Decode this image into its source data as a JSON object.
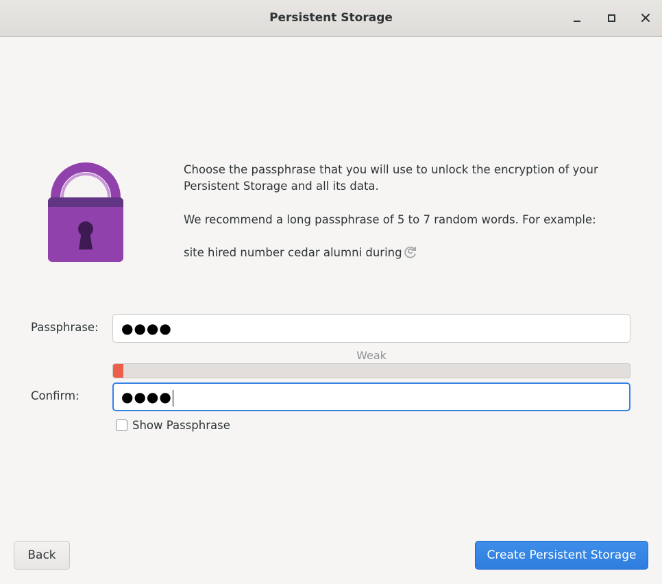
{
  "window": {
    "title": "Persistent Storage",
    "controls": {
      "minimize_icon": "minimize-icon",
      "maximize_icon": "maximize-icon",
      "close_icon": "close-icon"
    }
  },
  "illustration": {
    "icon": "padlock-icon",
    "color": "#9141ac"
  },
  "intro": {
    "line1": "Choose the passphrase that you will use to unlock the encryption of your",
    "line2": "Persistent Storage and all its data.",
    "recommendation": "We recommend a long passphrase of 5 to 7 random words. For example:",
    "example": "site hired number cedar alumni during",
    "refresh_icon": "refresh-icon"
  },
  "form": {
    "passphrase_label": "Passphrase:",
    "passphrase_value": "●●●●",
    "strength_label": "Weak",
    "strength_fraction": 0.02,
    "strength_color": "#ed5e4b",
    "confirm_label": "Confirm:",
    "confirm_value": "●●●●",
    "show_passphrase_label": "Show Passphrase",
    "show_passphrase_checked": false
  },
  "buttons": {
    "back": "Back",
    "create": "Create Persistent Storage"
  },
  "colors": {
    "accent": "#3584e4",
    "background": "#f6f5f4"
  }
}
